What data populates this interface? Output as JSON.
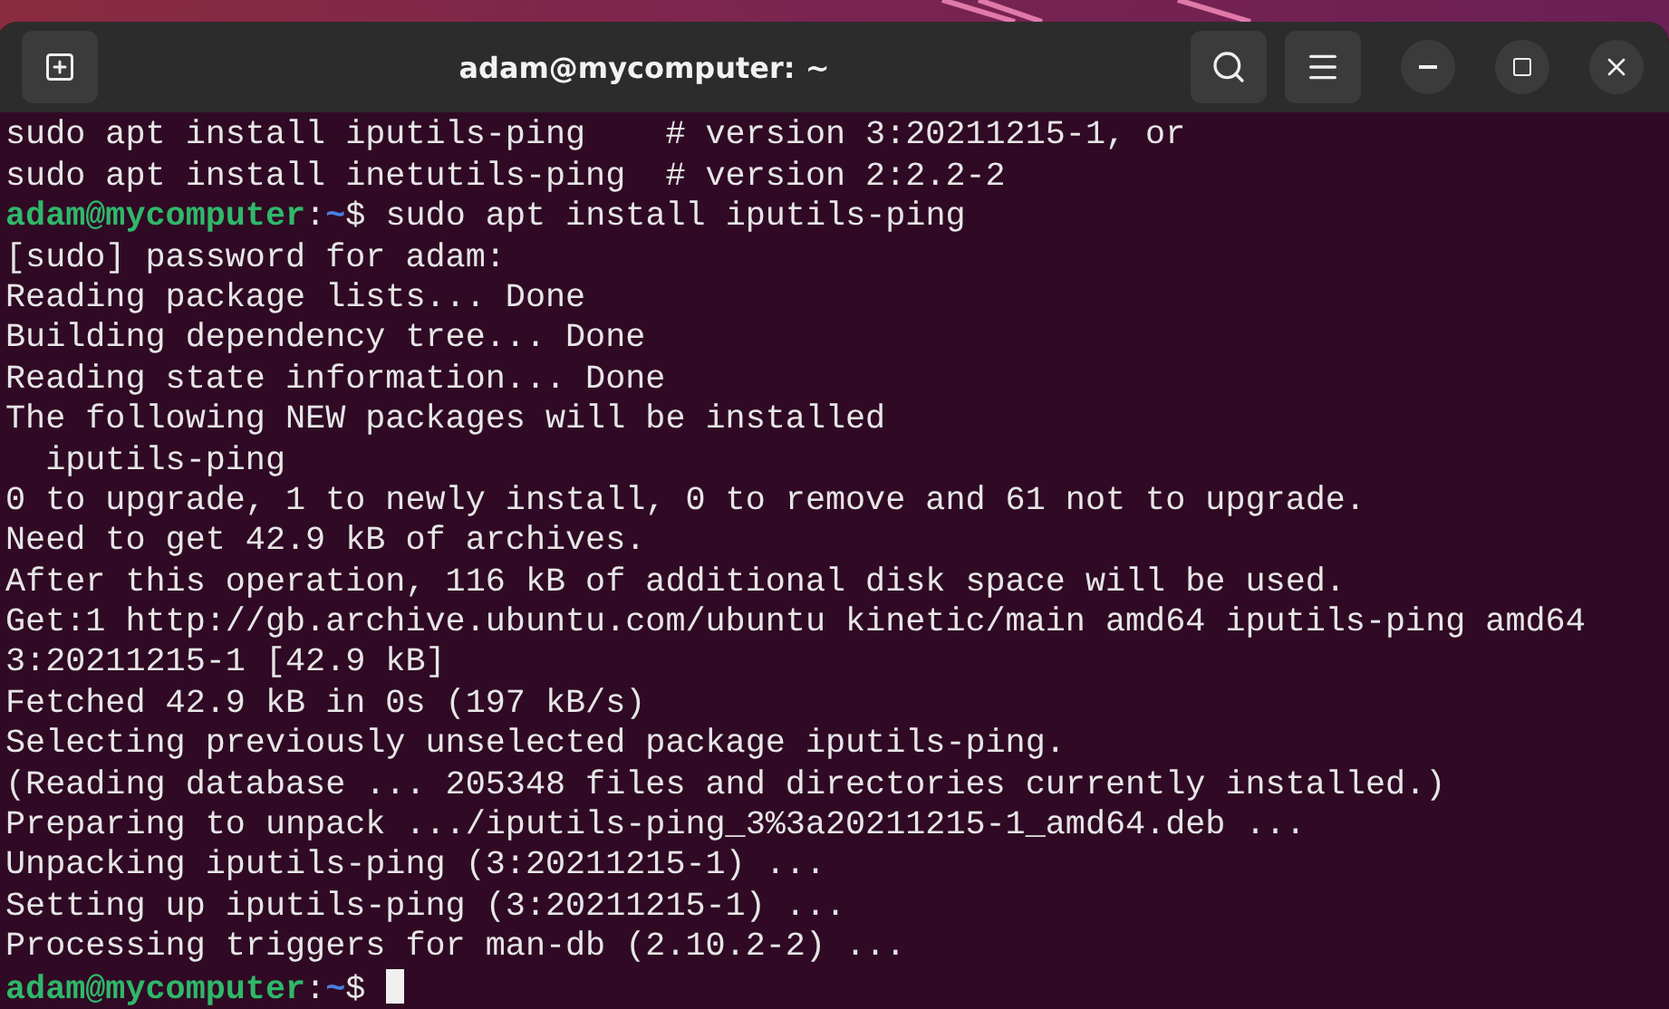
{
  "window": {
    "title": "adam@mycomputer: ~"
  },
  "terminal": {
    "lines": [
      {
        "kind": "output",
        "text": "sudo apt install iputils-ping    # version 3:20211215-1, or"
      },
      {
        "kind": "output",
        "text": "sudo apt install inetutils-ping  # version 2:2.2-2"
      },
      {
        "kind": "prompt",
        "user_host": "adam@mycomputer",
        "separator": ":",
        "path": "~",
        "symbol": "$",
        "command": "sudo apt install iputils-ping",
        "cursor": false
      },
      {
        "kind": "output",
        "text": "[sudo] password for adam:"
      },
      {
        "kind": "output",
        "text": "Reading package lists... Done"
      },
      {
        "kind": "output",
        "text": "Building dependency tree... Done"
      },
      {
        "kind": "output",
        "text": "Reading state information... Done"
      },
      {
        "kind": "output",
        "text": "The following NEW packages will be installed"
      },
      {
        "kind": "output",
        "text": "  iputils-ping"
      },
      {
        "kind": "output",
        "text": "0 to upgrade, 1 to newly install, 0 to remove and 61 not to upgrade."
      },
      {
        "kind": "output",
        "text": "Need to get 42.9 kB of archives."
      },
      {
        "kind": "output",
        "text": "After this operation, 116 kB of additional disk space will be used."
      },
      {
        "kind": "output",
        "text": "Get:1 http://gb.archive.ubuntu.com/ubuntu kinetic/main amd64 iputils-ping amd64"
      },
      {
        "kind": "output",
        "text": "3:20211215-1 [42.9 kB]"
      },
      {
        "kind": "output",
        "text": "Fetched 42.9 kB in 0s (197 kB/s)"
      },
      {
        "kind": "output",
        "text": "Selecting previously unselected package iputils-ping."
      },
      {
        "kind": "output",
        "text": "(Reading database ... 205348 files and directories currently installed.)"
      },
      {
        "kind": "output",
        "text": "Preparing to unpack .../iputils-ping_3%3a20211215-1_amd64.deb ..."
      },
      {
        "kind": "output",
        "text": "Unpacking iputils-ping (3:20211215-1) ..."
      },
      {
        "kind": "output",
        "text": "Setting up iputils-ping (3:20211215-1) ..."
      },
      {
        "kind": "output",
        "text": "Processing triggers for man-db (2.10.2-2) ..."
      },
      {
        "kind": "prompt",
        "user_host": "adam@mycomputer",
        "separator": ":",
        "path": "~",
        "symbol": "$",
        "cursor": true
      }
    ]
  }
}
